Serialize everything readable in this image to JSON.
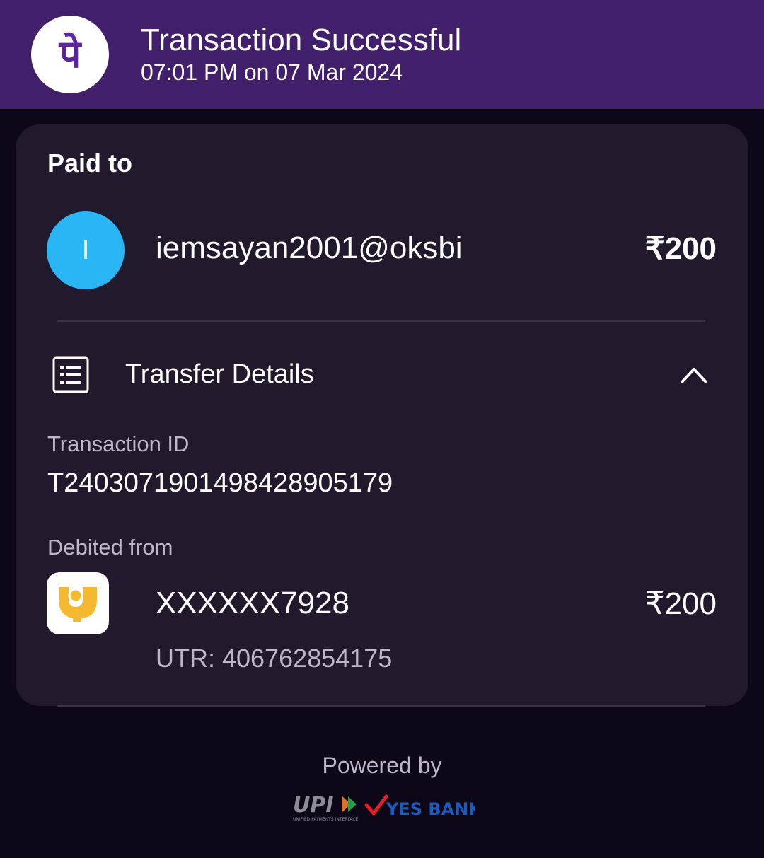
{
  "header": {
    "title": "Transaction Successful",
    "timestamp": "07:01 PM on 07 Mar 2024",
    "logo_icon": "phonepe-logo-icon",
    "logo_glyph": "पे"
  },
  "paid_to": {
    "label": "Paid to",
    "avatar_initial": "I",
    "avatar_color": "#2ab6f4",
    "upi_id": "iemsayan2001@oksbi",
    "amount": "₹200"
  },
  "transfer_details": {
    "title": "Transfer Details",
    "icon": "receipt-list-icon",
    "toggle_icon": "chevron-up-icon",
    "transaction_id_label": "Transaction ID",
    "transaction_id": "T2403071901498428905179",
    "debited_from_label": "Debited from",
    "bank_icon": "pnb-bank-logo-icon",
    "account_number": "XXXXXX7928",
    "amount": "₹200",
    "utr": "UTR: 406762854175"
  },
  "footer": {
    "powered_by": "Powered by",
    "upi_logo": "UPI",
    "upi_tagline": "UNIFIED PAYMENTS INTERFACE",
    "bank_logo": "YES BANK"
  },
  "colors": {
    "header_bg": "#421f6b",
    "page_bg": "#0d0817",
    "card_bg": "#201a2c",
    "brand_purple": "#5f259f"
  }
}
